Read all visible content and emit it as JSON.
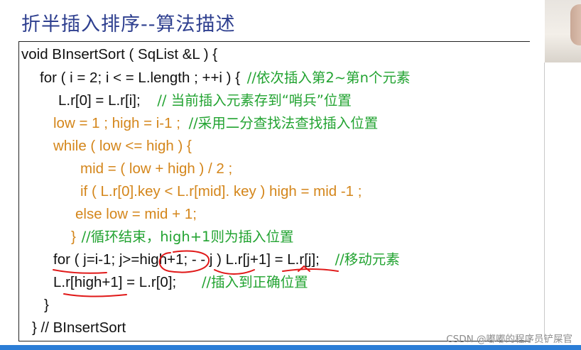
{
  "slide": {
    "title": "折半插入排序--算法描述"
  },
  "code": {
    "l1": "void  BInsertSort ( SqList &L ) {",
    "l2_code": "for ( i = 2;  i < = L.length ; ++i ) {",
    "l2_comment": "//依次插入第2~第n个元素",
    "l3_code": "L.r[0] = L.r[i];",
    "l3_comment": "// 当前插入元素存到“哨兵”位置",
    "l4_code": "low = 1 ; high = i-1 ;",
    "l4_comment": "//采用二分查找法查找插入位置",
    "l5": "while ( low <= high ) {",
    "l6": "mid = ( low + high ) / 2 ;",
    "l7a": "if  (  L.r[0].key < L.r[mid]. key  )  high = mid -1 ;",
    "l8": "else  low = mid + 1;",
    "l9_brace": "}",
    "l9_comment": "//循环结束，high+1则为插入位置",
    "l10_code": "for ( j=i-1; j>=high+1; - - j )  L.r[j+1] = L.r[j];",
    "l10_comment": "//移动元素",
    "l11_code": "L.r[high+1] = L.r[0];",
    "l11_comment": "//插入到正确位置",
    "l12": "}",
    "l13": "}  // BInsertSort"
  },
  "watermark": "CSDN @嘟嘟的程序员铲屎官",
  "colors": {
    "keyword_orange": "#d4861b",
    "comment_green": "#22a331",
    "title_blue": "#2e3f8f",
    "annotation_red": "#e01818",
    "bottom_bar_blue": "#2b7dd6"
  }
}
